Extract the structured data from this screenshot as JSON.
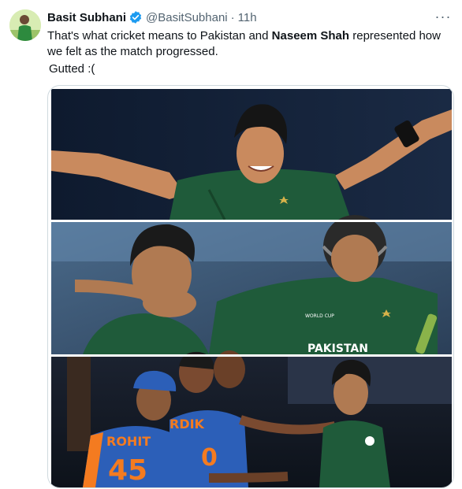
{
  "tweet": {
    "author": {
      "display_name": "Basit Subhani",
      "handle": "@BasitSubhani",
      "verified": true,
      "avatar_icon": "profile-avatar"
    },
    "separator": "·",
    "time": "11h",
    "text": {
      "part1": "That's what cricket means to Pakistan and ",
      "bold": "Naseem Shah",
      "part2": " represented how we felt as the match progressed.",
      "line3": "Gutted :("
    },
    "more_icon": "more-horizontal-icon",
    "more_label": "···"
  },
  "media": {
    "jersey_text": "PAKISTAN",
    "player_name": "ROHIT",
    "player_number": "45",
    "player2_name": "RDIK",
    "player2_number": "0",
    "badge_text": "WORLD CUP"
  },
  "colors": {
    "verified_blue": "#1d9bf0",
    "pakistan_green": "#1f5b3a",
    "india_blue": "#2c5fb8",
    "india_orange": "#f47b20",
    "secondary_text": "#536471"
  }
}
